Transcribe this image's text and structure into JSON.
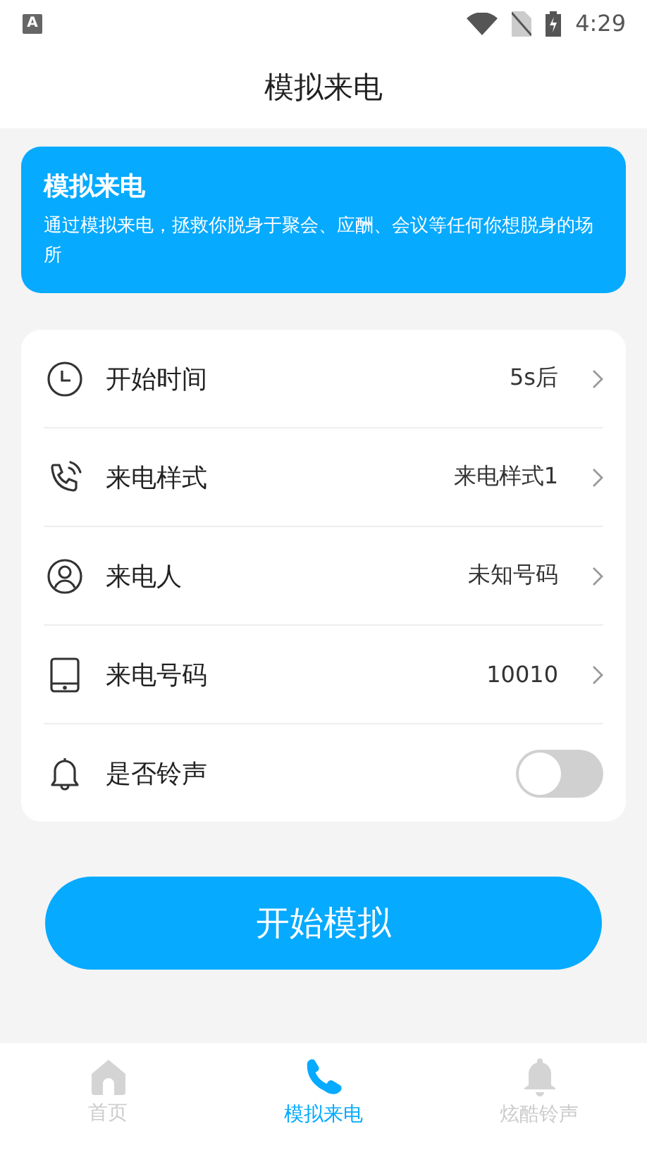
{
  "status_bar": {
    "app_badge": "A",
    "time": "4:29"
  },
  "header": {
    "title": "模拟来电"
  },
  "banner": {
    "title": "模拟来电",
    "text": "通过模拟来电，拯救你脱身于聚会、应酬、会议等任何你想脱身的场所"
  },
  "settings": [
    {
      "kind": "link",
      "label": "开始时间",
      "value": "5s后"
    },
    {
      "kind": "link",
      "label": "来电样式",
      "value": "来电样式1"
    },
    {
      "kind": "link",
      "label": "来电人",
      "value": "未知号码"
    },
    {
      "kind": "link",
      "label": "来电号码",
      "value": "10010"
    },
    {
      "kind": "toggle",
      "label": "是否铃声",
      "on": false
    }
  ],
  "start_button": "开始模拟",
  "tabs": [
    {
      "label": "首页",
      "selected": false
    },
    {
      "label": "模拟来电",
      "selected": true
    },
    {
      "label": "炫酷铃声",
      "selected": false
    }
  ]
}
